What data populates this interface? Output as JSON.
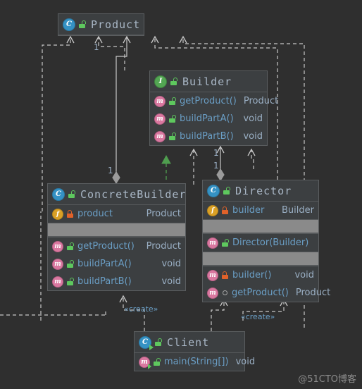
{
  "diagram": {
    "title": "Builder Pattern UML Class Diagram",
    "background": "#2f2f2f",
    "node_fill": "#3c3f41",
    "node_border": "#5a5d5f",
    "edge_color": "#c8c8c8",
    "realize_color": "#4f9e4f",
    "title_color": "#a9b7c6",
    "member_color": "#6a9ec5"
  },
  "nodes": {
    "product": {
      "name": "Product",
      "icon": "class-icon",
      "visibility_icon": "unlock-public-icon",
      "sections": []
    },
    "builder": {
      "name": "Builder",
      "icon": "interface-icon",
      "visibility_icon": "unlock-public-icon",
      "sections": [
        {
          "rows": [
            {
              "icon": "method-icon",
              "vis": "public",
              "name": "getProduct()",
              "type": "Product"
            },
            {
              "icon": "method-icon",
              "vis": "public",
              "name": "buildPartA()",
              "type": "void"
            },
            {
              "icon": "method-icon",
              "vis": "public",
              "name": "buildPartB()",
              "type": "void"
            }
          ]
        }
      ]
    },
    "concrete_builder": {
      "name": "ConcreteBuilder",
      "icon": "class-icon",
      "visibility_icon": "unlock-public-icon",
      "sections": [
        {
          "rows": [
            {
              "icon": "field-icon",
              "vis": "private",
              "name": "product",
              "type": "Product"
            }
          ]
        },
        {
          "separator": true
        },
        {
          "rows": [
            {
              "icon": "method-icon",
              "vis": "public",
              "name": "getProduct()",
              "type": "Product"
            },
            {
              "icon": "method-icon",
              "vis": "public",
              "name": "buildPartA()",
              "type": "void"
            },
            {
              "icon": "method-icon",
              "vis": "public",
              "name": "buildPartB()",
              "type": "void"
            }
          ]
        }
      ]
    },
    "director": {
      "name": "Director",
      "icon": "class-icon",
      "visibility_icon": "unlock-public-icon",
      "sections": [
        {
          "rows": [
            {
              "icon": "field-icon",
              "vis": "private",
              "name": "builder",
              "type": "Builder"
            }
          ]
        },
        {
          "separator": true
        },
        {
          "rows": [
            {
              "icon": "method-icon",
              "vis": "public",
              "name": "Director(Builder)",
              "type": ""
            }
          ]
        },
        {
          "separator": true
        },
        {
          "rows": [
            {
              "icon": "method-icon",
              "vis": "private",
              "name": "builder()",
              "type": "void"
            },
            {
              "icon": "method-icon",
              "vis": "package",
              "name": "getProduct()",
              "type": "Product"
            }
          ]
        }
      ]
    },
    "client": {
      "name": "Client",
      "icon": "runnable-class-icon",
      "visibility_icon": "unlock-public-icon",
      "sections": [
        {
          "rows": [
            {
              "icon": "runnable-method-icon",
              "vis": "public",
              "name": "main(String[])",
              "type": "void"
            }
          ]
        }
      ]
    }
  },
  "edge_labels": [
    {
      "key": "create_left",
      "text": "«create»"
    },
    {
      "key": "create_right",
      "text": "«create»"
    }
  ],
  "multiplicities": [
    {
      "key": "product_top",
      "text": "1"
    },
    {
      "key": "concrete_builder_agg",
      "text": "1"
    },
    {
      "key": "director_agg_upper",
      "text": "1"
    },
    {
      "key": "director_agg_lower",
      "text": "1"
    }
  ],
  "watermark": {
    "text": "@51CTO博客"
  }
}
